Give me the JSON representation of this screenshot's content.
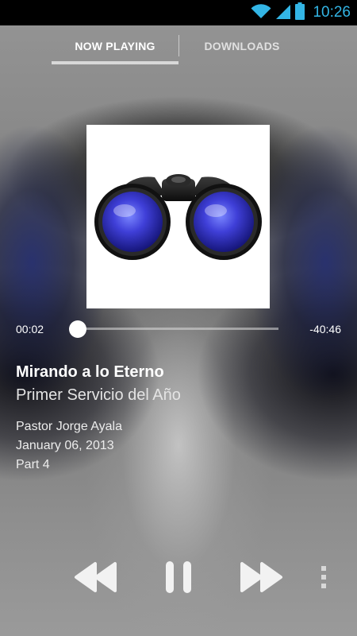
{
  "status_bar": {
    "time": "10:26"
  },
  "tabs": [
    {
      "label": "NOW PLAYING",
      "selected": true
    },
    {
      "label": "DOWNLOADS",
      "selected": false
    }
  ],
  "player": {
    "elapsed": "00:02",
    "remaining": "-40:46",
    "progress_fraction": 0.0,
    "artwork_icon": "binoculars-icon"
  },
  "track": {
    "title": "Mirando a lo Eterno",
    "series": "Primer Servicio del Año",
    "speaker": "Pastor Jorge Ayala",
    "date": "January 06, 2013",
    "part": "Part 4"
  },
  "controls": {
    "rewind_icon": "rewind-icon",
    "pause_icon": "pause-icon",
    "fast_forward_icon": "fast-forward-icon",
    "overflow_icon": "overflow-menu-icon"
  },
  "colors": {
    "accent": "#33b5e5",
    "background": "#8a8a8a"
  }
}
